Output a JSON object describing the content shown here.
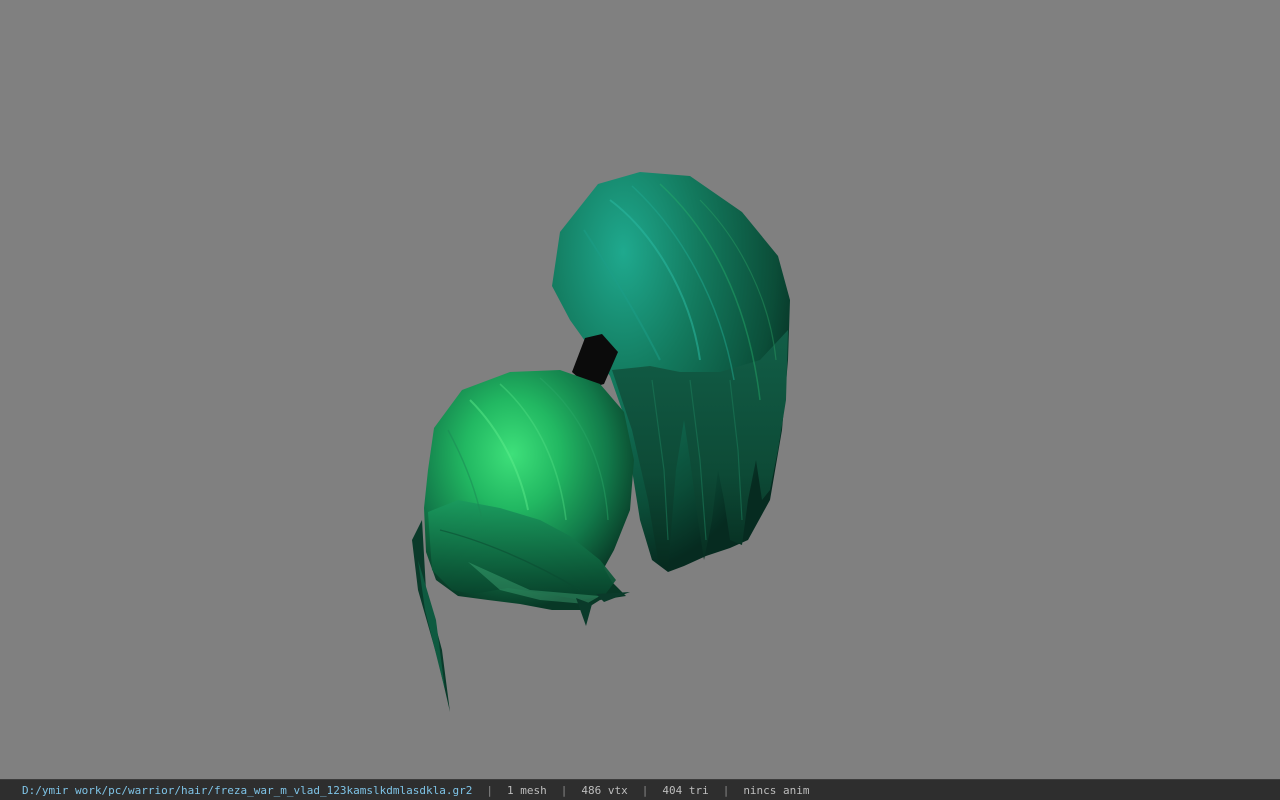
{
  "viewer": {
    "background_color": "#808080",
    "model_name": "green hair mesh",
    "model_colors": {
      "highlight": "#3ee07a",
      "mid": "#1a8f5c",
      "dark": "#0a3d2c",
      "teal": "#1a9a86",
      "tie": "#0b0b0b"
    }
  },
  "status": {
    "file_path": "D:/ymir work/pc/warrior/hair/freza_war_m_vlad_123kamslkdmlasdkla.gr2",
    "separator": "|",
    "mesh_count": "1 mesh",
    "vertex_count": "486 vtx",
    "triangle_count": "404 tri",
    "anim_status": "nincs anim"
  }
}
